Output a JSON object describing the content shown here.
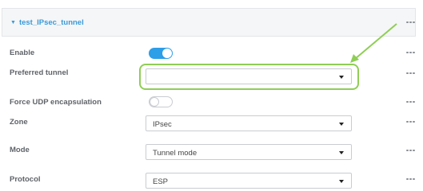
{
  "section": {
    "title": "test_IPsec_tunnel"
  },
  "fields": {
    "enable": {
      "label": "Enable",
      "state": "on"
    },
    "preferred_tunnel": {
      "label": "Preferred tunnel",
      "value": ""
    },
    "force_udp": {
      "label": "Force UDP encapsulation",
      "state": "off"
    },
    "zone": {
      "label": "Zone",
      "value": "IPsec"
    },
    "mode": {
      "label": "Mode",
      "value": "Tunnel mode"
    },
    "protocol": {
      "label": "Protocol",
      "value": "ESP"
    }
  },
  "colors": {
    "accent": "#3b9ad9",
    "toggle_on": "#2d9ee8",
    "annotation": "#8fce55"
  },
  "icons": [
    "caret-down-icon",
    "more-icon",
    "chevron-down-icon",
    "annotation-arrow"
  ]
}
